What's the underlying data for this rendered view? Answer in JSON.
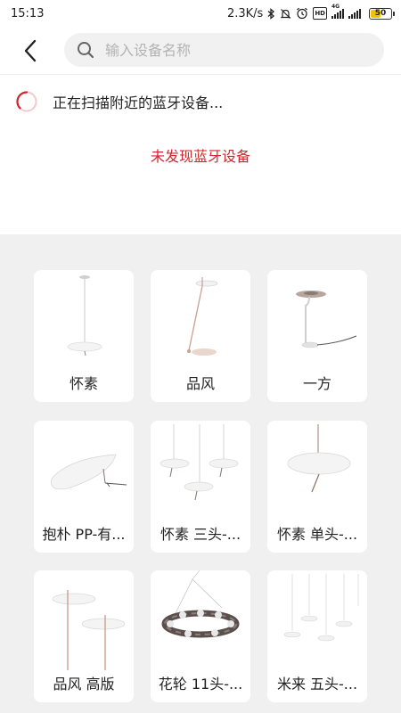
{
  "status_bar": {
    "time": "15:13",
    "speed": "2.3K/s",
    "network_badge": "4G",
    "hd_badge": "HD",
    "battery": "50",
    "battery_level": 0.5
  },
  "header": {
    "back_icon": "back-arrow-icon",
    "search_icon": "search-icon",
    "search_placeholder": "输入设备名称",
    "search_value": ""
  },
  "scan": {
    "status_text": "正在扫描附近的蓝牙设备...",
    "empty_text": "未发现蓝牙设备",
    "accent_color": "#d0262e"
  },
  "products": [
    {
      "label": "怀素"
    },
    {
      "label": "品风"
    },
    {
      "label": "一方"
    },
    {
      "label": "抱朴 PP-有..."
    },
    {
      "label": "怀素 三头-..."
    },
    {
      "label": "怀素 单头-..."
    },
    {
      "label": "品风 高版"
    },
    {
      "label": "花轮 11头-..."
    },
    {
      "label": "米来 五头-..."
    }
  ]
}
